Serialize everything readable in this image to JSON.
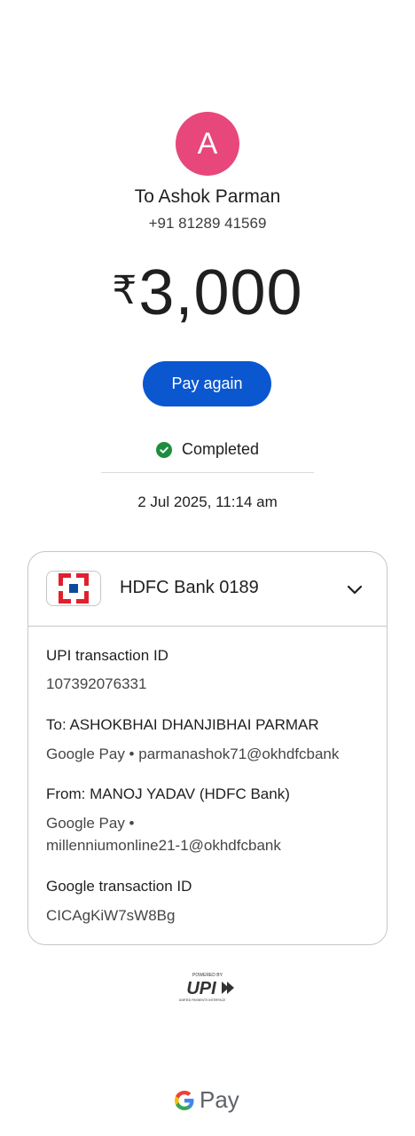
{
  "recipient": {
    "avatar_letter": "A",
    "avatar_color": "#e8477c",
    "to_name": "To Ashok Parman",
    "phone": "+91 81289 41569"
  },
  "payment": {
    "currency_symbol": "₹",
    "amount": "3,000",
    "pay_again_label": "Pay again",
    "status": "Completed",
    "status_color": "#1e8e3e",
    "datetime": "2 Jul 2025, 11:14 am"
  },
  "card": {
    "bank_logo": "hdfc-bank-logo",
    "bank_name": "HDFC Bank 0189",
    "expand_icon": "chevron-down-icon",
    "details": [
      {
        "label": "UPI transaction ID",
        "value": "107392076331"
      },
      {
        "label": "To: ASHOKBHAI DHANJIBHAI PARMAR",
        "value": "Google Pay • parmanashok71@okhdfcbank"
      },
      {
        "label": "From: MANOJ YADAV (HDFC Bank)",
        "value_line1": "Google Pay •",
        "value_line2": "millenniumonline21-1@okhdfcbank"
      },
      {
        "label": "Google transaction ID",
        "value": "CICAgKiW7sW8Bg"
      }
    ]
  },
  "footer": {
    "upi_powered_by": "POWERED BY",
    "upi_logo_text": "UPI",
    "upi_tagline": "UNIFIED PAYMENTS INTERFACE",
    "gpay_g": "G",
    "gpay_pay": "Pay"
  },
  "colors": {
    "primary_button": "#0b57d0",
    "hdfc_red": "#e0202f",
    "hdfc_blue": "#0c4a9a"
  }
}
